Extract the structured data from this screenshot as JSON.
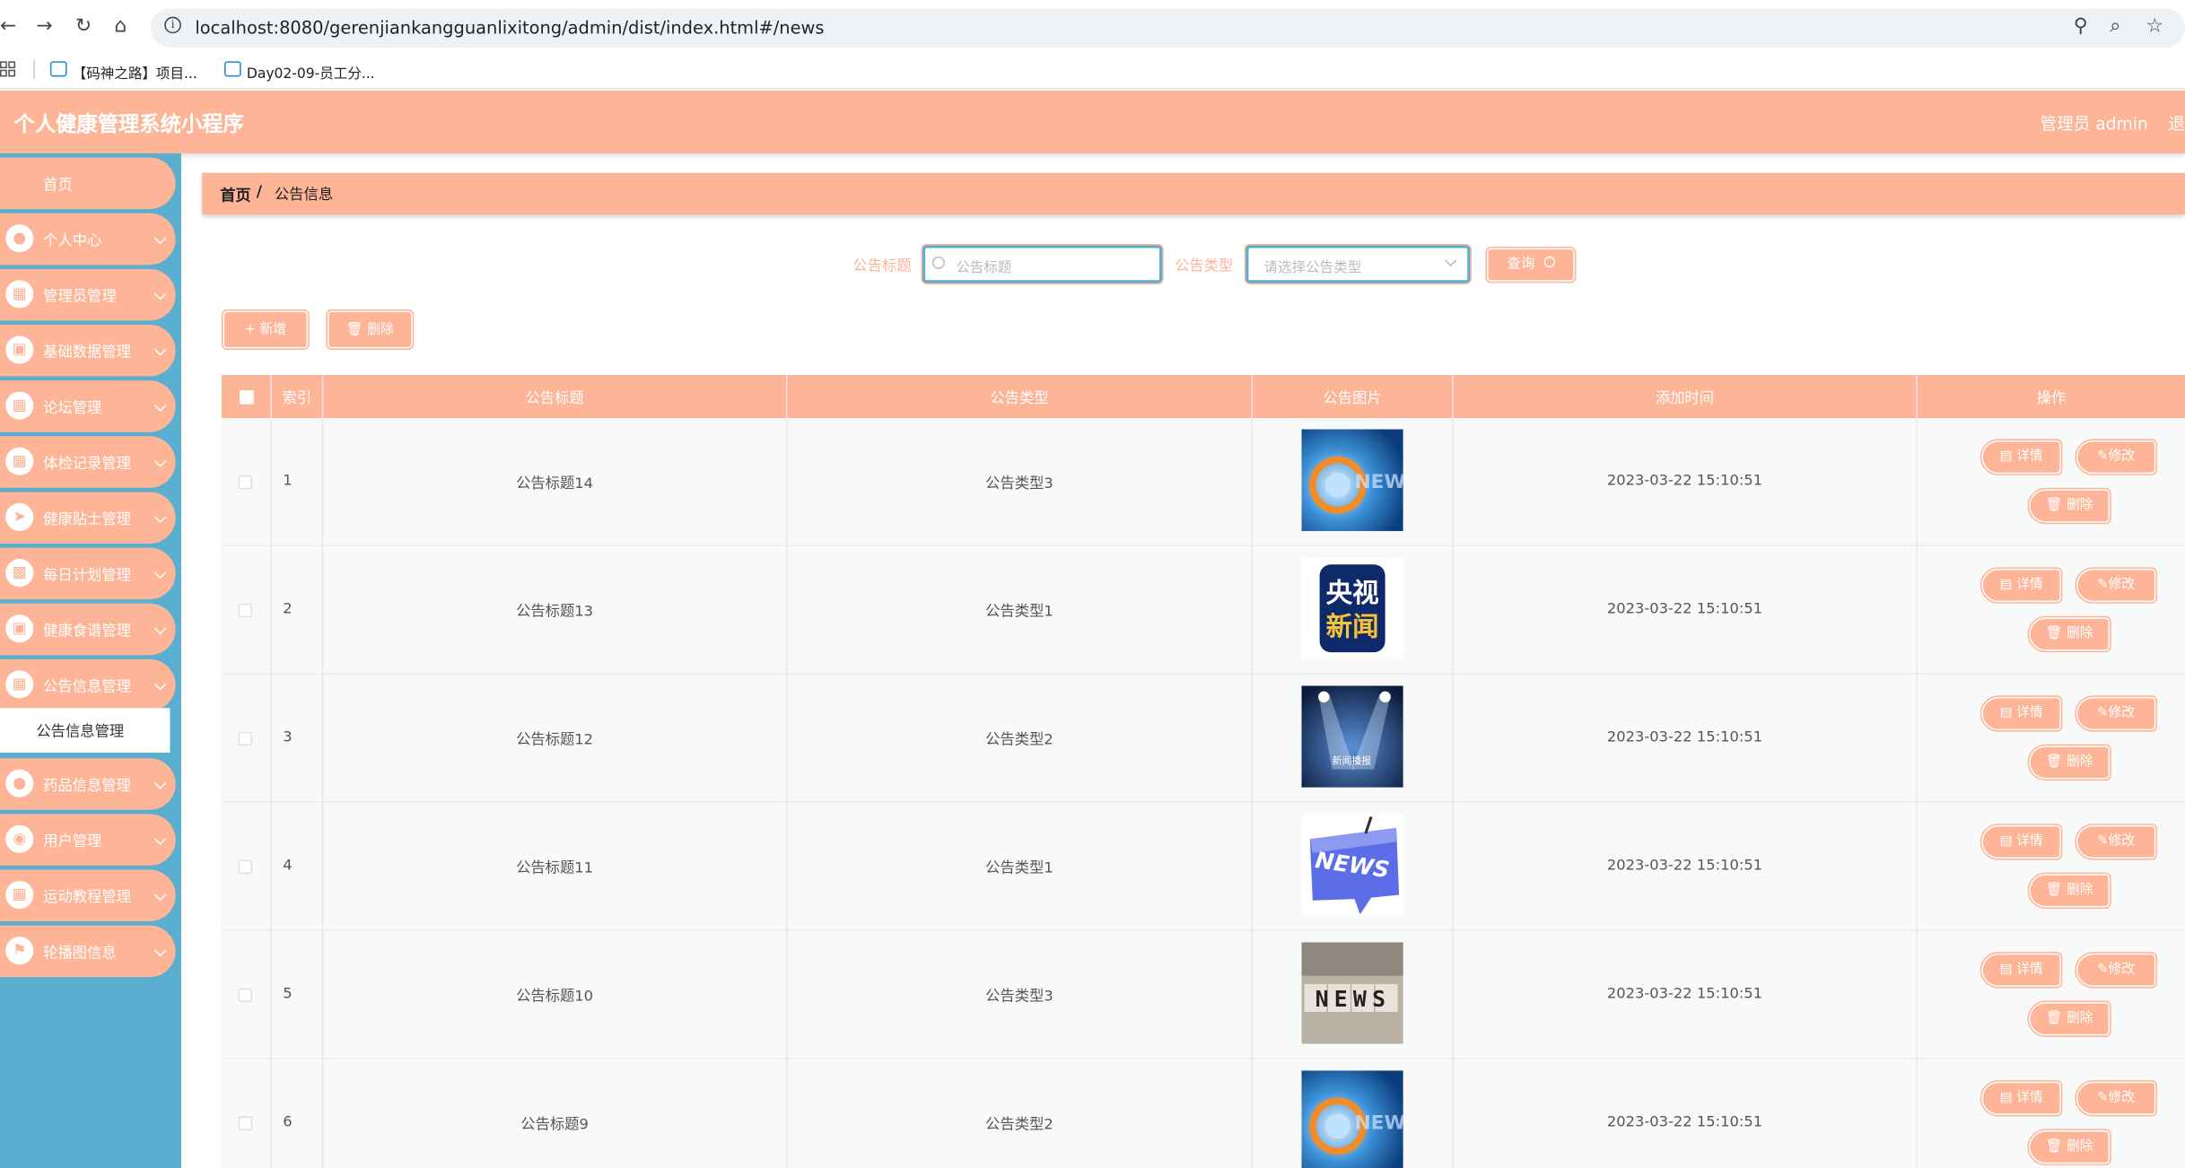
{
  "browser": {
    "url": "localhost:8080/gerenjiankangguanlixitong/admin/dist/index.html#/news",
    "bookmarks": [
      "【码神之路】项目...",
      "Day02-09-员工分..."
    ]
  },
  "app": {
    "title": "个人健康管理系统小程序",
    "admin_label": "管理员 admin",
    "logout_label": "退"
  },
  "sidebar": {
    "items": [
      {
        "label": "首页"
      },
      {
        "label": "个人中心"
      },
      {
        "label": "管理员管理"
      },
      {
        "label": "基础数据管理"
      },
      {
        "label": "论坛管理"
      },
      {
        "label": "体检记录管理"
      },
      {
        "label": "健康贴士管理"
      },
      {
        "label": "每日计划管理"
      },
      {
        "label": "健康食谱管理"
      },
      {
        "label": "公告信息管理"
      },
      {
        "label": "药品信息管理"
      },
      {
        "label": "用户管理"
      },
      {
        "label": "运动教程管理"
      },
      {
        "label": "轮播图信息"
      }
    ],
    "sub_item": "公告信息管理"
  },
  "breadcrumb": {
    "home": "首页",
    "separator": "/",
    "current": "公告信息"
  },
  "search": {
    "title_label": "公告标题",
    "title_placeholder": "公告标题",
    "type_label": "公告类型",
    "type_placeholder": "请选择公告类型",
    "query_label": "查询"
  },
  "actions": {
    "add_label": "+ 新增",
    "delete_label": "删除"
  },
  "table": {
    "columns": [
      "索引",
      "公告标题",
      "公告类型",
      "公告图片",
      "添加时间",
      "操作"
    ],
    "rows": [
      {
        "index": "1",
        "title": "公告标题14",
        "type": "公告类型3",
        "time": "2023-03-22 15:10:51",
        "image": "news-globe"
      },
      {
        "index": "2",
        "title": "公告标题13",
        "type": "公告类型1",
        "time": "2023-03-22 15:10:51",
        "image": "cctv-news"
      },
      {
        "index": "3",
        "title": "公告标题12",
        "type": "公告类型2",
        "time": "2023-03-22 15:10:51",
        "image": "spotlight-news"
      },
      {
        "index": "4",
        "title": "公告标题11",
        "type": "公告类型1",
        "time": "2023-03-22 15:10:51",
        "image": "news-speech-bubble"
      },
      {
        "index": "5",
        "title": "公告标题10",
        "type": "公告类型3",
        "time": "2023-03-22 15:10:51",
        "image": "news-letter-tiles"
      },
      {
        "index": "6",
        "title": "公告标题9",
        "type": "公告类型2",
        "time": "2023-03-22 15:10:51",
        "image": "news-globe"
      }
    ],
    "row_actions": {
      "detail": "详情",
      "edit": "修改",
      "delete": "删除"
    }
  },
  "thumb_text": {
    "cctv": [
      "央视",
      "新闻"
    ],
    "spotlight": "新闻播报",
    "bubble": "NEWS",
    "tiles": "NEWS",
    "globe": "NEWS"
  },
  "colors": {
    "accent": "#fdb497",
    "sidebar": "#5aafd1",
    "focus_border": "#5aafd1"
  }
}
